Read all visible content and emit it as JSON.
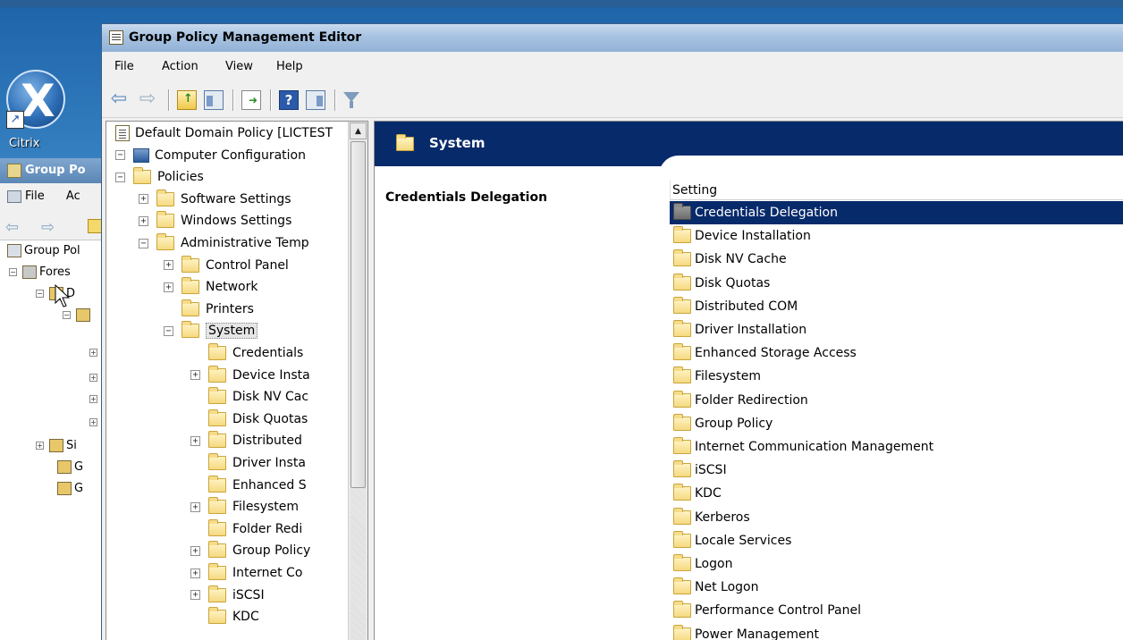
{
  "desktop": {
    "icon_label": "Citrix"
  },
  "bg_window": {
    "title": "Group Po",
    "menu": [
      "File",
      "Ac"
    ],
    "tree": [
      {
        "label": "Group Pol",
        "indent": 0,
        "toggle": ""
      },
      {
        "label": "Fores",
        "indent": 1,
        "toggle": "−"
      },
      {
        "label": "D",
        "indent": 2,
        "toggle": "−"
      },
      {
        "label": "",
        "indent": 3,
        "toggle": "−"
      },
      {
        "label": "Si",
        "indent": 1,
        "toggle": "+"
      },
      {
        "label": "G",
        "indent": 2,
        "toggle": ""
      },
      {
        "label": "G",
        "indent": 2,
        "toggle": ""
      }
    ]
  },
  "window": {
    "title": "Group Policy Management Editor"
  },
  "menu": {
    "items": [
      "File",
      "Action",
      "View",
      "Help"
    ]
  },
  "toolbar": {
    "buttons": [
      "back-icon",
      "forward-icon",
      "up-folder-icon",
      "show-hide-tree-icon",
      "export-list-icon",
      "help-icon",
      "show-hide-action-pane-icon",
      "filter-icon"
    ]
  },
  "tree": {
    "nodes": [
      {
        "label": "Default Domain Policy [LICTEST",
        "level": 0,
        "toggle": "",
        "icon": "document"
      },
      {
        "label": "Computer Configuration",
        "level": 0,
        "toggle": "−",
        "icon": "computer"
      },
      {
        "label": "Policies",
        "level": 1,
        "toggle": "−",
        "icon": "folder"
      },
      {
        "label": "Software Settings",
        "level": 2,
        "toggle": "+",
        "icon": "folder"
      },
      {
        "label": "Windows Settings",
        "level": 2,
        "toggle": "+",
        "icon": "folder"
      },
      {
        "label": "Administrative Temp",
        "level": 2,
        "toggle": "−",
        "icon": "folder"
      },
      {
        "label": "Control Panel",
        "level": 3,
        "toggle": "+",
        "icon": "folder"
      },
      {
        "label": "Network",
        "level": 3,
        "toggle": "+",
        "icon": "folder"
      },
      {
        "label": "Printers",
        "level": 3,
        "toggle": "",
        "icon": "folder"
      },
      {
        "label": "System",
        "level": 3,
        "toggle": "−",
        "icon": "folder",
        "selected": true
      },
      {
        "label": "Credentials",
        "level": 4,
        "toggle": "",
        "icon": "folder"
      },
      {
        "label": "Device Insta",
        "level": 4,
        "toggle": "+",
        "icon": "folder"
      },
      {
        "label": "Disk NV Cac",
        "level": 4,
        "toggle": "",
        "icon": "folder"
      },
      {
        "label": "Disk Quotas",
        "level": 4,
        "toggle": "",
        "icon": "folder"
      },
      {
        "label": "Distributed",
        "level": 4,
        "toggle": "+",
        "icon": "folder"
      },
      {
        "label": "Driver Insta",
        "level": 4,
        "toggle": "",
        "icon": "folder"
      },
      {
        "label": "Enhanced S",
        "level": 4,
        "toggle": "",
        "icon": "folder"
      },
      {
        "label": "Filesystem",
        "level": 4,
        "toggle": "+",
        "icon": "folder"
      },
      {
        "label": "Folder Redi",
        "level": 4,
        "toggle": "",
        "icon": "folder"
      },
      {
        "label": "Group Policy",
        "level": 4,
        "toggle": "+",
        "icon": "folder"
      },
      {
        "label": "Internet Co",
        "level": 4,
        "toggle": "+",
        "icon": "folder"
      },
      {
        "label": "iSCSI",
        "level": 4,
        "toggle": "+",
        "icon": "folder"
      },
      {
        "label": "KDC",
        "level": 4,
        "toggle": "",
        "icon": "folder"
      }
    ]
  },
  "content": {
    "banner_title": "System",
    "selected_heading": "Credentials Delegation",
    "column_header": "Setting",
    "rows": [
      {
        "label": "Credentials Delegation",
        "selected": true
      },
      {
        "label": "Device Installation"
      },
      {
        "label": "Disk NV Cache"
      },
      {
        "label": "Disk Quotas"
      },
      {
        "label": "Distributed COM"
      },
      {
        "label": "Driver Installation"
      },
      {
        "label": "Enhanced Storage Access"
      },
      {
        "label": "Filesystem"
      },
      {
        "label": "Folder Redirection"
      },
      {
        "label": "Group Policy"
      },
      {
        "label": "Internet Communication Management"
      },
      {
        "label": "iSCSI"
      },
      {
        "label": "KDC"
      },
      {
        "label": "Kerberos"
      },
      {
        "label": "Locale Services"
      },
      {
        "label": "Logon"
      },
      {
        "label": "Net Logon"
      },
      {
        "label": "Performance Control Panel"
      },
      {
        "label": "Power Management"
      }
    ]
  },
  "colors": {
    "banner": "#072a6a",
    "selection": "#072a6a",
    "folder": "#f5d980"
  }
}
